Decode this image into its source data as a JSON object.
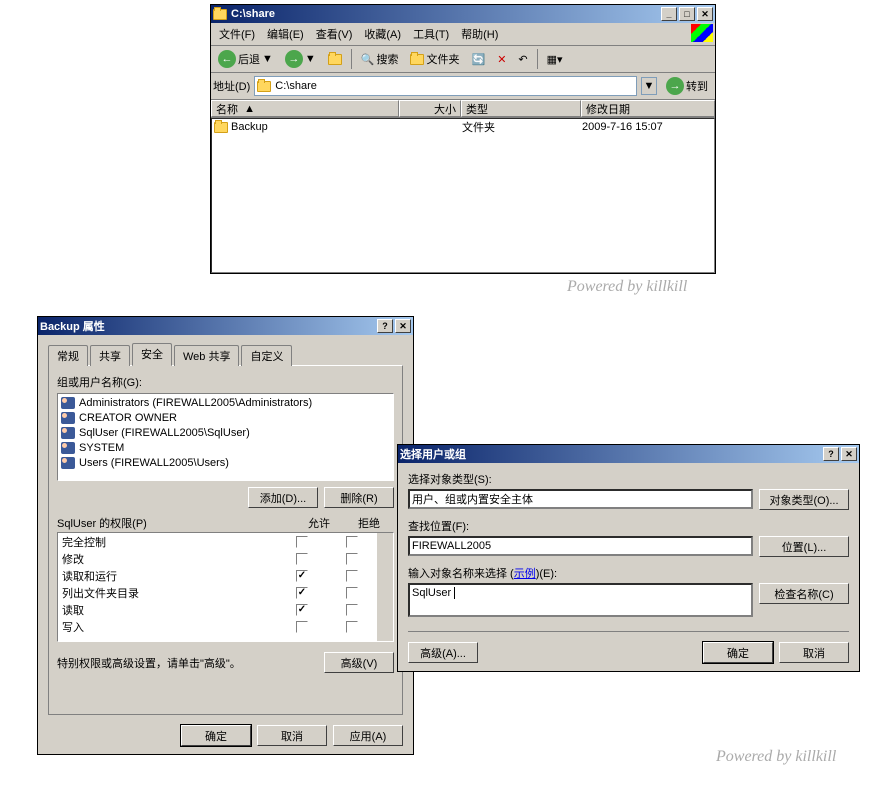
{
  "explorer": {
    "title": "C:\\share",
    "menus": [
      "文件(F)",
      "编辑(E)",
      "查看(V)",
      "收藏(A)",
      "工具(T)",
      "帮助(H)"
    ],
    "toolbar": {
      "back": "后退",
      "search": "搜索",
      "folders": "文件夹"
    },
    "address": {
      "label": "地址(D)",
      "value": "C:\\share",
      "go": "转到"
    },
    "columns": {
      "name": "名称",
      "size": "大小",
      "type": "类型",
      "modified": "修改日期"
    },
    "items": [
      {
        "name": "Backup",
        "type": "文件夹",
        "modified": "2009-7-16 15:07"
      }
    ]
  },
  "properties": {
    "title": "Backup 属性",
    "tabs": [
      "常规",
      "共享",
      "安全",
      "Web 共享",
      "自定义"
    ],
    "active_tab": 2,
    "groups_label": "组或用户名称(G):",
    "users": [
      "Administrators (FIREWALL2005\\Administrators)",
      "CREATOR OWNER",
      "SqlUser (FIREWALL2005\\SqlUser)",
      "SYSTEM",
      "Users (FIREWALL2005\\Users)"
    ],
    "add_btn": "添加(D)...",
    "remove_btn": "删除(R)",
    "perm_for": "SqlUser 的权限(P)",
    "allow": "允许",
    "deny": "拒绝",
    "perms": [
      {
        "name": "完全控制",
        "allow": false,
        "deny": false
      },
      {
        "name": "修改",
        "allow": false,
        "deny": false
      },
      {
        "name": "读取和运行",
        "allow": true,
        "deny": false
      },
      {
        "name": "列出文件夹目录",
        "allow": true,
        "deny": false
      },
      {
        "name": "读取",
        "allow": true,
        "deny": false
      },
      {
        "name": "写入",
        "allow": false,
        "deny": false
      }
    ],
    "special_text": "特别权限或高级设置，请单击\"高级\"。",
    "advanced_btn": "高级(V)",
    "ok": "确定",
    "cancel": "取消",
    "apply": "应用(A)"
  },
  "select": {
    "title": "选择用户或组",
    "obj_type_label": "选择对象类型(S):",
    "obj_type_value": "用户、组或内置安全主体",
    "obj_type_btn": "对象类型(O)...",
    "location_label": "查找位置(F):",
    "location_value": "FIREWALL2005",
    "location_btn": "位置(L)...",
    "name_label_1": "输入对象名称来选择 (",
    "name_label_link": "示例",
    "name_label_2": ")(E):",
    "name_value": "SqlUser",
    "check_btn": "检查名称(C)",
    "advanced_btn": "高级(A)...",
    "ok": "确定",
    "cancel": "取消"
  },
  "watermark": "Powered by killkill"
}
